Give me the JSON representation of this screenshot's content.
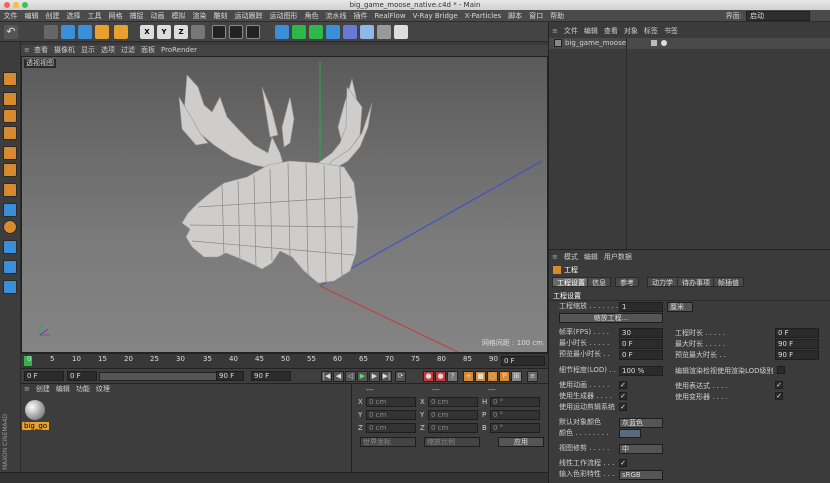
{
  "window": {
    "title": "big_game_moose_native.c4d * - Main"
  },
  "menu": {
    "items": [
      "文件",
      "编辑",
      "创建",
      "选择",
      "工具",
      "网格",
      "捕捉",
      "动画",
      "模拟",
      "渲染",
      "雕刻",
      "运动跟踪",
      "运动图形",
      "角色",
      "流水线",
      "插件",
      "RealFlow",
      "V-Ray Bridge",
      "X-Particles",
      "脚本",
      "窗口",
      "帮助"
    ],
    "layout_label": "界面:",
    "layout_value": "启动"
  },
  "viewport": {
    "menu": [
      "查看",
      "摄像机",
      "显示",
      "选项",
      "过滤",
      "面板",
      "ProRender"
    ],
    "label": "透视视图",
    "grid_info": "网格间距 : 100 cm"
  },
  "timeline": {
    "ticks": [
      "0",
      "5",
      "10",
      "15",
      "20",
      "25",
      "30",
      "35",
      "40",
      "45",
      "50",
      "55",
      "60",
      "65",
      "70",
      "75",
      "80",
      "85",
      "90"
    ],
    "current": "0 F"
  },
  "transport": {
    "start": "0 F",
    "start2": "0 F",
    "end": "90 F",
    "end2": "90 F"
  },
  "material_panel": {
    "menu": [
      "创建",
      "编辑",
      "功能",
      "纹理"
    ],
    "material_name": "big_go"
  },
  "coord_panel": {
    "headers": [
      "---",
      "---",
      "---"
    ],
    "rows": [
      {
        "a": "X",
        "av": "0 cm",
        "b": "X",
        "bv": "0 cm",
        "c": "H",
        "cv": "0 °"
      },
      {
        "a": "Y",
        "av": "0 cm",
        "b": "Y",
        "bv": "0 cm",
        "c": "P",
        "cv": "0 °"
      },
      {
        "a": "Z",
        "av": "0 cm",
        "b": "Z",
        "bv": "0 cm",
        "c": "B",
        "cv": "0 °"
      }
    ],
    "dropdown1": "世界坐标",
    "dropdown2": "缩放比例",
    "apply": "应用"
  },
  "object_panel": {
    "menu": [
      "文件",
      "编辑",
      "查看",
      "对象",
      "标签",
      "书签"
    ],
    "object_name": "big_game_moose"
  },
  "attr_panel": {
    "menu": [
      "模式",
      "编辑",
      "用户数据"
    ],
    "section_title": "工程",
    "tabs": [
      "工程设置",
      "信息",
      "参考",
      "动力学",
      "待办事项",
      "帧插值"
    ],
    "group_title": "工程设置",
    "scale_label": "工程缩放 . . . . . . . .",
    "scale_value": "1",
    "scale_unit": "厘米",
    "scale_button": "缩放工程...",
    "fields": [
      {
        "l": "帧率(FPS) . . . .",
        "v": "30",
        "l2": "工程时长 . . . . .",
        "v2": "0 F"
      },
      {
        "l": "最小时长 . . . . .",
        "v": "0 F",
        "l2": "最大时长 . . . . .",
        "v2": "90 F"
      },
      {
        "l": "预览最小时长 . .",
        "v": "0 F",
        "l2": "预览最大时长 . .",
        "v2": "90 F"
      }
    ],
    "lod_label": "细节程度(LOD) . .",
    "lod_value": "100 %",
    "lod_render_label": "编辑渲染检视使用渲染LOD级别",
    "checks": [
      {
        "l": "使用动画 . . . . .",
        "l2": "使用表达式 . . . ."
      },
      {
        "l": "使用生成器 . . . .",
        "l2": "使用变形器 . . . ."
      },
      {
        "l": "使用运动剪辑系统"
      }
    ],
    "default_color_label": "默认对象颜色",
    "default_color_value": "灰蓝色",
    "color_label": "颜色 . . . . . . . .",
    "view_clip_label": "视图修剪 . . . . .",
    "view_clip_value": "中",
    "linear_label": "线性工作流程 . . .",
    "input_color_label": "输入色彩特性 . . .",
    "input_color_value": "sRGB"
  },
  "brand": "MAXON CINEMA4D"
}
